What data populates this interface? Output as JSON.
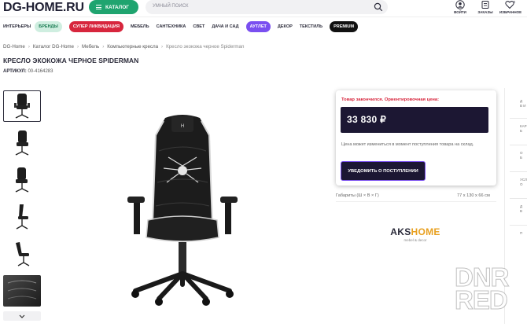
{
  "header": {
    "logo": "DG-HOME.RU",
    "catalog_label": "КАТАЛОГ",
    "search_placeholder": "УМНЫЙ ПОИСК",
    "account_label": "ВОЙТИ",
    "orders_label": "ЗАКАЗЫ",
    "favorites_label": "ИЗБРАННОЕ",
    "favorites_count": "0"
  },
  "nav": {
    "items": [
      "ИНТЕРЬЕРЫ",
      "БРЕНДЫ",
      "СУПЕР ЛИКВИДАЦИЯ",
      "МЕБЕЛЬ",
      "САНТЕХНИКА",
      "СВЕТ",
      "ДАЧА И САД",
      "АУТЛЕТ",
      "ДЕКОР",
      "ТЕКСТИЛЬ",
      "PREMIUM"
    ]
  },
  "breadcrumb": {
    "items": [
      "DG-Home",
      "Каталог DG-Home",
      "Мебель",
      "Компьютерные кресла",
      "Кресло экокожа черное Spiderman"
    ],
    "separator": "›"
  },
  "product": {
    "title": "КРЕСЛО ЭКОКОЖА ЧЕРНОЕ SPIDERMAN",
    "sku_label": "АРТИКУЛ:",
    "sku_value": "00-4164283"
  },
  "offer": {
    "out_of_stock_note": "Товар закончился. Ориентировочная цена:",
    "price": "33 830",
    "currency": "₽",
    "price_desc": "Цена может измениться в момент поступления товара на склад.",
    "notify_label": "УВЕДОМИТЬ О ПОСТУПЛЕНИИ"
  },
  "specs": {
    "dimensions_label": "Габариты (Ш × В × Г)",
    "dimensions_value": "77 x 130 x 66 см"
  },
  "brand": {
    "name_part1": "AKS",
    "name_part2": "HOME",
    "tagline": "mebel & decor"
  },
  "right_rail": {
    "snippets": [
      "Д\nВ И",
      "КАР\nБ",
      "О\nБ",
      "УСЛ\nО",
      "Д\nВ",
      "П"
    ]
  },
  "watermark": {
    "line1": "DNR",
    "line2": "RED"
  },
  "colors": {
    "brand_green": "#1fa46f",
    "dark_navy": "#1c1733",
    "alert_red": "#d7263d",
    "accent_purple": "#7a4ff0"
  },
  "icons": [
    "hamburger-icon",
    "search-icon",
    "user-icon",
    "orders-icon",
    "heart-icon",
    "chevron-down-icon",
    "ruble-icon"
  ]
}
